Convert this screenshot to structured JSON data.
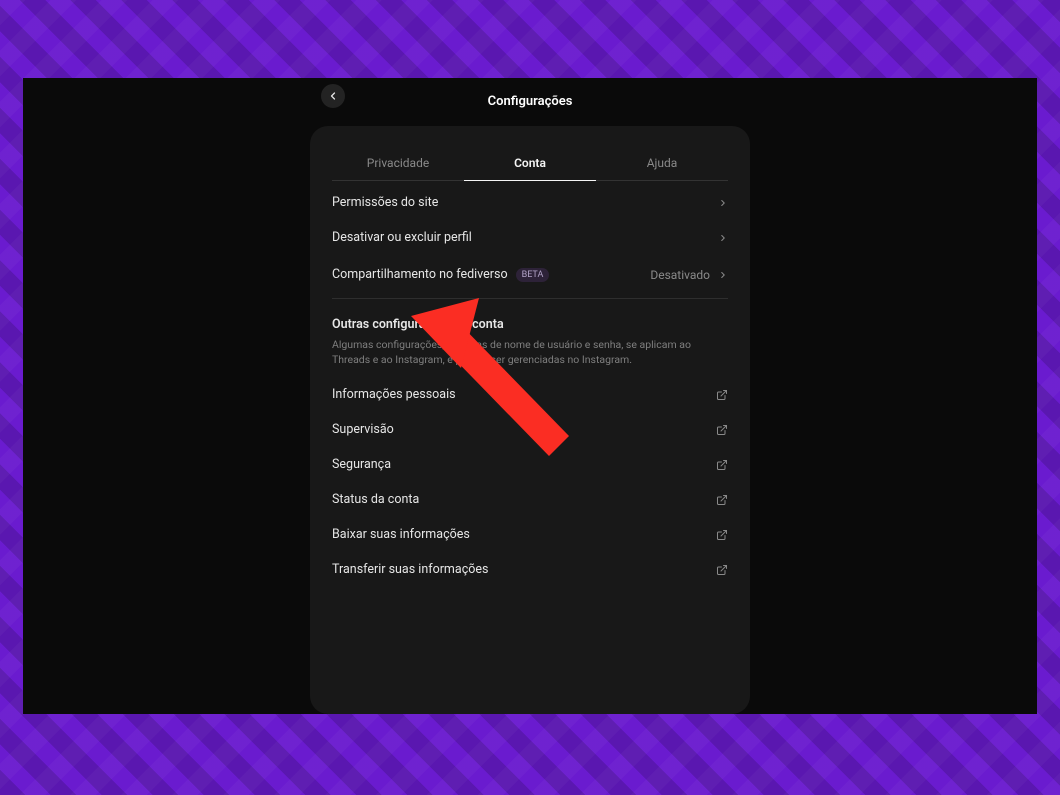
{
  "page_title": "Configurações",
  "tabs": {
    "privacy": "Privacidade",
    "account": "Conta",
    "help": "Ajuda"
  },
  "account_rows": {
    "site_permissions": "Permissões do site",
    "deactivate_delete": "Desativar ou excluir perfil",
    "fediverse_sharing": "Compartilhamento no fediverso",
    "fediverse_badge": "BETA",
    "fediverse_status": "Desativado"
  },
  "other_section": {
    "title": "Outras configurações da conta",
    "description": "Algumas configurações, como as de nome de usuário e senha, se aplicam ao Threads e ao Instagram, e podem ser gerenciadas no Instagram."
  },
  "other_rows": {
    "personal_info": "Informações pessoais",
    "supervision": "Supervisão",
    "security": "Segurança",
    "account_status": "Status da conta",
    "download_info": "Baixar suas informações",
    "transfer_info": "Transferir suas informações"
  },
  "colors": {
    "backdrop": "#6a1bcf",
    "window": "#0a0a0a",
    "panel": "#181818",
    "arrow": "#fb2d23"
  }
}
